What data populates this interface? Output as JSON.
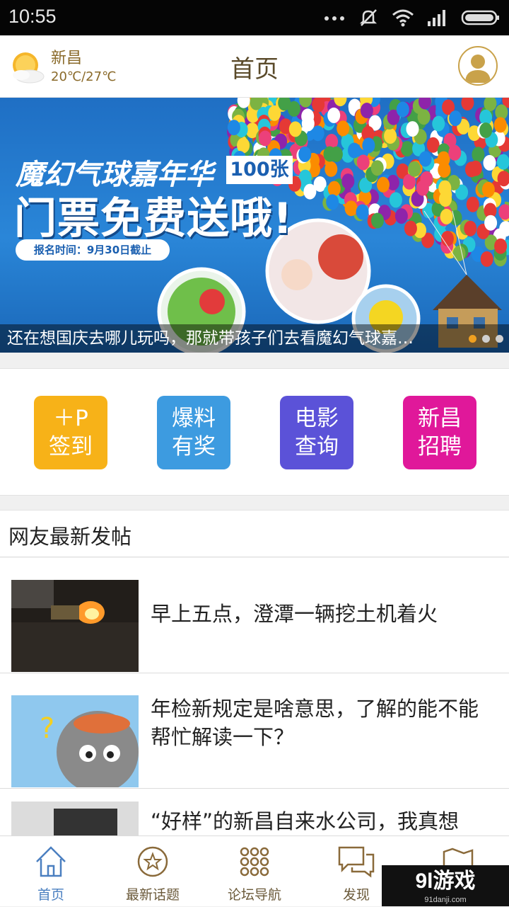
{
  "status_bar": {
    "time": "10:55"
  },
  "header": {
    "city": "新昌",
    "temperature": "20℃/27℃",
    "title": "首页",
    "icons": [
      "sun-cloud-icon",
      "user-avatar-icon"
    ]
  },
  "banner": {
    "headline": "魔幻气球嘉年华",
    "badge": "100张",
    "big_text": "门票免费送哦!",
    "deadline": "报名时间：9月30日截止",
    "caption": "还在想国庆去哪儿玩吗，那就带孩子们去看魔幻气球嘉…",
    "page_count": 3,
    "active_index": 0
  },
  "quick_actions": [
    {
      "line1": "＋P",
      "line2": "签到",
      "color": "#f7b218"
    },
    {
      "line1": "爆料",
      "line2": "有奖",
      "color": "#3d9be0"
    },
    {
      "line1": "电影",
      "line2": "查询",
      "color": "#5b52d8"
    },
    {
      "line1": "新昌",
      "line2": "招聘",
      "color": "#e0189a"
    }
  ],
  "section": {
    "title": "网友最新发帖"
  },
  "posts": [
    {
      "title": "早上五点，澄潭一辆挖土机着火"
    },
    {
      "title": "年检新规定是啥意思，了解的能不能帮忙解读一下？"
    },
    {
      "title": "“好样”的新昌自来水公司，我真想"
    }
  ],
  "tabs": [
    {
      "label": "首页",
      "icon": "home-icon",
      "active": true
    },
    {
      "label": "最新话题",
      "icon": "star-icon",
      "active": false
    },
    {
      "label": "论坛导航",
      "icon": "grid-icon",
      "active": false
    },
    {
      "label": "发现",
      "icon": "chat-icon",
      "active": false
    },
    {
      "label": "",
      "icon": "map-icon",
      "active": false
    }
  ],
  "watermark": {
    "text": "9l游戏",
    "sub": "91danji.com"
  }
}
